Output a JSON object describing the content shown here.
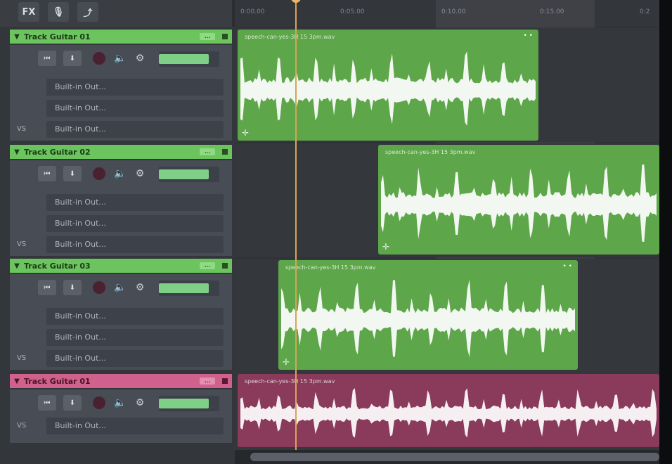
{
  "toolbar": {
    "fx_label": "FX",
    "buttons": [
      {
        "name": "fx-button",
        "label": "FX"
      },
      {
        "name": "mic-icon",
        "label": "🎙"
      },
      {
        "name": "automation-icon",
        "label": "⤴"
      }
    ]
  },
  "timeline": {
    "ticks": [
      "0:00.00",
      "0:05.00",
      "0:10.00",
      "0:15.00",
      "0:2"
    ],
    "clip_name": "speech-can-yes-3H 15 3pm.wav"
  },
  "tracks": [
    {
      "name": "Track Guitar 01",
      "color": "#6bc45d",
      "volume_fraction": 0.82,
      "outputs": [
        "Built-in Out...",
        "Built-in Out...",
        "Built-in Out..."
      ],
      "clip_color": "#5ea64a"
    },
    {
      "name": "Track Guitar 02",
      "color": "#6bc45d",
      "volume_fraction": 0.82,
      "outputs": [
        "Built-in Out...",
        "Built-in Out...",
        "Built-in Out..."
      ],
      "clip_color": "#5ea64a"
    },
    {
      "name": "Track Guitar 03",
      "color": "#6bc45d",
      "volume_fraction": 0.82,
      "outputs": [
        "Built-in Out...",
        "Built-in Out...",
        "Built-in Out..."
      ],
      "clip_color": "#5ea64a"
    },
    {
      "name": "Track Guitar 01",
      "color": "#d0608c",
      "volume_fraction": 0.82,
      "outputs": [
        "Built-in Out..."
      ],
      "clip_color": "#8a3a5a"
    }
  ],
  "labels": {
    "vs": "VS",
    "mini_tag": "...",
    "skip_icon": "⏮",
    "pin_icon": "⬇",
    "speaker_icon": "🔈",
    "gear_icon": "⚙",
    "plus": "✛",
    "dots": "• •"
  },
  "colors": {
    "accent": "#6bc45d",
    "pink": "#d0608c",
    "playhead": "#d8a455"
  }
}
